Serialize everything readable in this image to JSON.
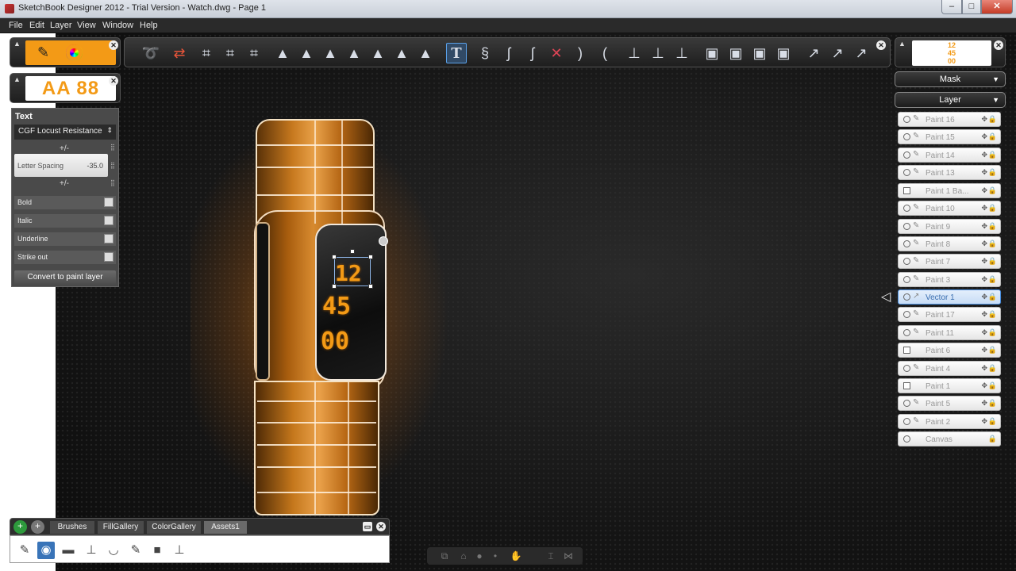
{
  "window": {
    "title": "SketchBook Designer 2012 - Trial Version - Watch.dwg - Page 1",
    "min": "–",
    "max": "□",
    "close": "✕"
  },
  "menu": [
    "File",
    "Edit",
    "Layer",
    "View",
    "Window",
    "Help"
  ],
  "toolbar": {
    "icons": [
      "lasso-select-icon",
      "transform-icon",
      "crop-icon",
      "crop-grid-icon",
      "crop-perspective-icon",
      "marker-pen-icon",
      "ink-pen-icon",
      "pencil-icon",
      "airbrush-pen-icon",
      "calligraphy-pen-icon",
      "bucket-pen-icon",
      "ink-nib-icon",
      "text-tool-icon",
      "curve-1-icon",
      "curve-2-icon",
      "curve-3-icon",
      "curve-4-icon",
      "arc-icon",
      "arc-2-icon",
      "pin-1-icon",
      "pin-2-icon",
      "pin-3-icon",
      "shape-1-icon",
      "shape-2-icon",
      "shape-3-icon",
      "shape-4-icon",
      "arrow-1-icon",
      "arrow-2-icon",
      "arrow-3-icon"
    ],
    "active": "text-tool-icon"
  },
  "font_preview": "AA 88",
  "thumbnail_text": [
    "12",
    "45",
    "00"
  ],
  "text_panel": {
    "header": "Text",
    "font": "CGF Locust Resistance",
    "plus_minus": "+/-",
    "letter_spacing_label": "Letter Spacing",
    "letter_spacing_value": "-35.0",
    "options": [
      "Bold",
      "Italic",
      "Underline",
      "Strike out"
    ],
    "convert_button": "Convert to paint layer"
  },
  "right_panel": {
    "mask_label": "Mask",
    "layer_label": "Layer",
    "layers": [
      "Paint 16",
      "Paint 15",
      "Paint 14",
      "Paint 13",
      "Paint 1 Ba...",
      "Paint 10",
      "Paint 9",
      "Paint 8",
      "Paint 7",
      "Paint 3",
      "Vector 1",
      "Paint 17",
      "Paint 11",
      "Paint 6",
      "Paint 4",
      "Paint 1",
      "Paint 5",
      "Paint 2",
      "Canvas"
    ],
    "active_layer": "Vector 1"
  },
  "watch": {
    "hour": "12",
    "minute": "45",
    "second": "00"
  },
  "bottom": {
    "tabs": [
      "Brushes",
      "FillGallery",
      "ColorGallery",
      "Assets1"
    ],
    "active_tab": "Assets1"
  },
  "colors": {
    "accent_orange": "#f39a16",
    "selection_blue": "#4a8fe0"
  }
}
